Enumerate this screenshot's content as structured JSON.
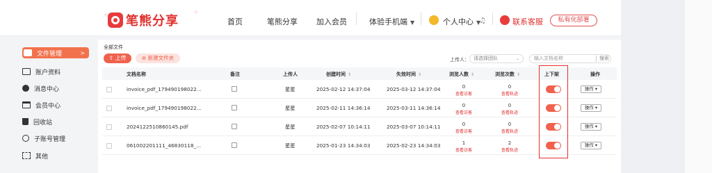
{
  "brand": {
    "name": "笔熊分享",
    "color": "#e0302f"
  },
  "nav": {
    "items": [
      "首页",
      "笔熊分享",
      "加入会员"
    ],
    "app_download": "体验手机端",
    "user_center": "个人中心",
    "customer_service": "联系客服",
    "private_deploy": "私有化部署"
  },
  "sidebar": {
    "items": [
      {
        "label": "文件管理",
        "icon": "folder-icon",
        "active": true
      },
      {
        "label": "账户资料",
        "icon": "id-card-icon"
      },
      {
        "label": "消息中心",
        "icon": "message-icon"
      },
      {
        "label": "会员中心",
        "icon": "card-icon"
      },
      {
        "label": "回收站",
        "icon": "trash-icon"
      },
      {
        "label": "子账号管理",
        "icon": "sub-account-icon"
      },
      {
        "label": "其他",
        "icon": "grid-icon"
      }
    ]
  },
  "main": {
    "breadcrumb": "全部文件",
    "upload_label": "上传",
    "new_folder_label": "新建文件夹",
    "uploader_label": "上传人：",
    "uploader_placeholder": "请选择团队",
    "search_placeholder": "输入文档名称",
    "search_button": "搜索"
  },
  "table": {
    "headers": {
      "name": "文档名称",
      "note": "备注",
      "uploader": "上传人",
      "created": "创建时间",
      "expire": "失效时间",
      "viewers": "浏览人数",
      "views": "浏览次数",
      "shelf": "上下架",
      "action": "操作"
    },
    "view_link_label": "查看访客",
    "view_track_label": "查看轨迹",
    "action_label": "操作",
    "rows": [
      {
        "name": "invoice_pdf_179490198022...",
        "uploader": "星星",
        "created": "2025-02-12 14:37:04",
        "expire": "2025-03-12 14:37:04",
        "viewers": "0",
        "views": "0",
        "on": true
      },
      {
        "name": "invoice_pdf_179490198022...",
        "uploader": "星星",
        "created": "2025-02-11 14:36:14",
        "expire": "2025-03-11 14:36:14",
        "viewers": "0",
        "views": "0",
        "on": true
      },
      {
        "name": "2024122510860145.pdf",
        "uploader": "星星",
        "created": "2025-02-07 10:14:11",
        "expire": "2025-03-07 10:14:11",
        "viewers": "0",
        "views": "0",
        "on": true
      },
      {
        "name": "061002201111_46830118_...",
        "uploader": "星星",
        "created": "2025-01-23 14:34:03",
        "expire": "2025-02-23 14:34:03",
        "viewers": "1",
        "views": "2",
        "on": true
      }
    ]
  }
}
